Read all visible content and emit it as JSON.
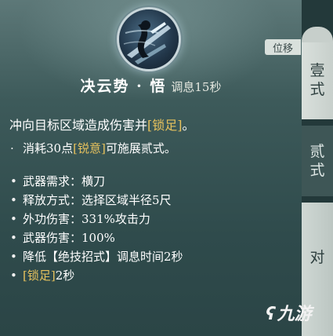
{
  "skill": {
    "name": "决云势 · 悟",
    "cooldown": "调息15秒",
    "icon": "sword-slash-icon"
  },
  "description": {
    "prefix": "冲向目标区域造成伤害并",
    "keyword": "[锁足]",
    "suffix": "。"
  },
  "cost_line": {
    "bullet": "·",
    "prefix": "消耗30点",
    "keyword": "[锐意]",
    "suffix": "可施展贰式。"
  },
  "attributes": [
    {
      "bullet": "•",
      "text": "武器需求：横刀"
    },
    {
      "bullet": "•",
      "text": "释放方式：选择区域半径5尺"
    },
    {
      "bullet": "•",
      "text": "外功伤害：331%攻击力"
    },
    {
      "bullet": "•",
      "text": "武器伤害：100%"
    },
    {
      "bullet": "•",
      "text": "降低【绝技招式】调息时间2秒"
    }
  ],
  "root_line": {
    "bullet": "•",
    "keyword": "[锁足]",
    "value": "2秒"
  },
  "tags": {
    "displacement": "位移"
  },
  "tabs": [
    {
      "line1": "壹",
      "line2": "式"
    },
    {
      "line1": "贰",
      "line2": "式"
    },
    {
      "line1": "对",
      "line2": ""
    }
  ],
  "watermark": {
    "logo": "ʕ",
    "text": "九游"
  },
  "colors": {
    "highlight": "#e7c25d",
    "panel": "#3d5a5a",
    "text": "#ffffff"
  }
}
